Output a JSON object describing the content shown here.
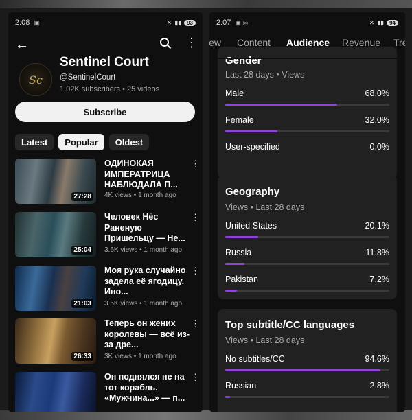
{
  "left": {
    "status": {
      "time": "2:08",
      "battery": "93"
    },
    "channel": {
      "name": "Sentinel Court",
      "handle": "@SentinelCourt",
      "stats": "1.02K subscribers • 25 videos",
      "avatar_text": "Sc"
    },
    "subscribe_label": "Subscribe",
    "chips": [
      "Latest",
      "Popular",
      "Oldest"
    ],
    "videos": [
      {
        "title": "ОДИНОКАЯ ИМПЕРАТРИЦА НАБЛЮДАЛА П...",
        "meta": "4K views • 1 month ago",
        "duration": "27:28"
      },
      {
        "title": "Человек Нёс Раненую Пришельцу — Не...",
        "meta": "3.6K views • 1 month ago",
        "duration": "25:04"
      },
      {
        "title": "Моя рука случайно задела её ягодицу. Ино...",
        "meta": "3.5K views • 1 month ago",
        "duration": "21:03"
      },
      {
        "title": "Теперь он жених королевы — всё из-за дре...",
        "meta": "3K views • 1 month ago",
        "duration": "26:33"
      },
      {
        "title": "Он поднялся не на тот корабль. «Мужчина...» — п...",
        "meta": "",
        "duration": ""
      }
    ]
  },
  "right": {
    "status": {
      "time": "2:07",
      "battery": "94"
    },
    "tabs": [
      "iew",
      "Content",
      "Audience",
      "Revenue",
      "Tre"
    ],
    "gender": {
      "title": "Gender",
      "subtitle": "Last 28 days • Views",
      "rows": [
        {
          "label": "Male",
          "value": "68.0%",
          "pct": 68.0
        },
        {
          "label": "Female",
          "value": "32.0%",
          "pct": 32.0
        },
        {
          "label": "User-specified",
          "value": "0.0%",
          "pct": 0.0
        }
      ]
    },
    "geography": {
      "title": "Geography",
      "subtitle": "Views • Last 28 days",
      "rows": [
        {
          "label": "United States",
          "value": "20.1%",
          "pct": 20.1
        },
        {
          "label": "Russia",
          "value": "11.8%",
          "pct": 11.8
        },
        {
          "label": "Pakistan",
          "value": "7.2%",
          "pct": 7.2
        }
      ]
    },
    "subtitles": {
      "title": "Top subtitle/CC languages",
      "subtitle": "Views • Last 28 days",
      "rows": [
        {
          "label": "No subtitles/CC",
          "value": "94.6%",
          "pct": 94.6
        },
        {
          "label": "Russian",
          "value": "2.8%",
          "pct": 2.8
        }
      ]
    },
    "accent_color": "#8e44d6"
  }
}
